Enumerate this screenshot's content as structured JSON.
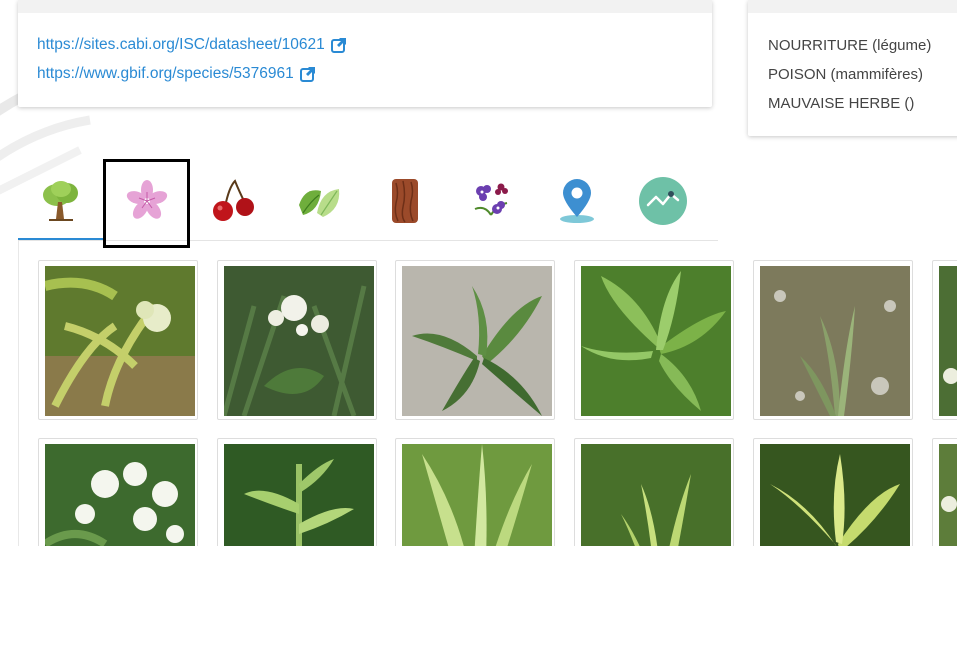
{
  "links": [
    {
      "url": "https://sites.cabi.org/ISC/datasheet/10621",
      "icon": "external-link-icon"
    },
    {
      "url": "https://www.gbif.org/species/5376961",
      "icon": "external-link-icon"
    }
  ],
  "uses": [
    "NOURRITURE (légume)",
    "POISON (mammifères)",
    "MAUVAISE HERBE ()"
  ],
  "tabs": [
    {
      "icon": "tree-icon",
      "active": true
    },
    {
      "icon": "flower-icon",
      "selected": true
    },
    {
      "icon": "cherry-fruit-icon"
    },
    {
      "icon": "leaf-icon"
    },
    {
      "icon": "bark-icon"
    },
    {
      "icon": "plant-flowers-icon"
    },
    {
      "icon": "map-pin-icon"
    },
    {
      "icon": "chart-line-icon"
    }
  ],
  "colors": {
    "link": "#2a8ad4",
    "tab_underline": "#2a8ad4",
    "selection_frame": "#000000"
  },
  "gallery": {
    "rows": 2,
    "columns_visible": 6,
    "image_count_visible": 12
  }
}
